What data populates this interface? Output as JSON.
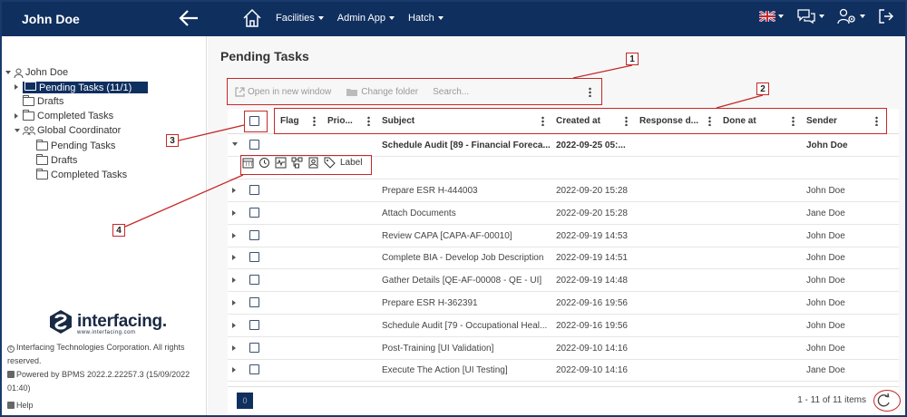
{
  "topbar": {
    "user_name": "John Doe",
    "menu": [
      {
        "label": "Facilities"
      },
      {
        "label": "Admin App"
      },
      {
        "label": "Hatch"
      }
    ]
  },
  "sidebar": {
    "tree": {
      "root": "John Doe",
      "items": [
        {
          "label": "Pending Tasks (11/1)"
        },
        {
          "label": "Drafts"
        },
        {
          "label": "Completed Tasks"
        }
      ],
      "group": "Global Coordinator",
      "group_items": [
        {
          "label": "Pending Tasks"
        },
        {
          "label": "Drafts"
        },
        {
          "label": "Completed Tasks"
        }
      ]
    },
    "logo_text": "interfacing.",
    "logo_sub": "www.interfacing.com",
    "copyright": "Interfacing Technologies Corporation. All rights reserved.",
    "powered": "Powered by BPMS 2022.2.22257.3 (15/09/2022 01:40)",
    "help": "Help"
  },
  "main": {
    "title": "Pending Tasks",
    "toolbar": {
      "open_new_window": "Open in new window",
      "change_folder": "Change folder",
      "search_placeholder": "Search..."
    },
    "columns": [
      "Flag",
      "Prio...",
      "Subject",
      "Created at",
      "Response d...",
      "Done at",
      "Sender"
    ],
    "group_row": {
      "subject": "Schedule Audit [89 - Financial Foreca...",
      "created": "2022-09-25 05:...",
      "sender": "John Doe"
    },
    "action_label": "Label",
    "rows": [
      {
        "subject": "Prepare ESR H-444003",
        "created": "2022-09-20 15:28",
        "sender": "John Doe"
      },
      {
        "subject": "Attach Documents",
        "created": "2022-09-20 15:28",
        "sender": "Jane Doe"
      },
      {
        "subject": "Review CAPA [CAPA-AF-00010]",
        "created": "2022-09-19 14:53",
        "sender": "John Doe"
      },
      {
        "subject": "Complete BIA - Develop Job Description",
        "created": "2022-09-19 14:51",
        "sender": "John Doe"
      },
      {
        "subject": "Gather Details [QE-AF-00008 - QE - UI]",
        "created": "2022-09-19 14:48",
        "sender": "John Doe"
      },
      {
        "subject": "Prepare ESR H-362391",
        "created": "2022-09-16 19:56",
        "sender": "John Doe"
      },
      {
        "subject": "Schedule Audit [79 - Occupational Heal...",
        "created": "2022-09-16 19:56",
        "sender": "John Doe"
      },
      {
        "subject": "Post-Training [UI Validation]",
        "created": "2022-09-10 14:16",
        "sender": "John Doe"
      },
      {
        "subject": "Execute The Action [UI Testing]",
        "created": "2022-09-10 14:16",
        "sender": "Jane Doe"
      }
    ],
    "pager": {
      "page": "0",
      "info": "1 - 11 of 11 items"
    }
  },
  "annotations": [
    "1",
    "2",
    "3",
    "4"
  ]
}
